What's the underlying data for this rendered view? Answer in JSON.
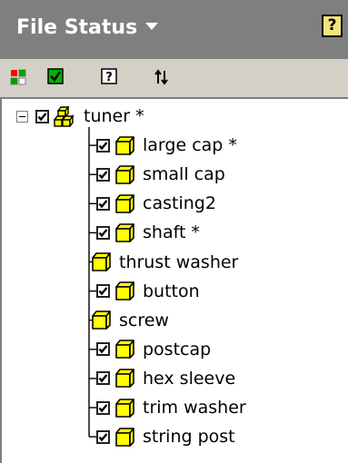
{
  "header": {
    "title": "File Status",
    "help_label": "?"
  },
  "toolbar": {
    "buttons": [
      {
        "icon": "status-grid-icon"
      },
      {
        "icon": "checkmark-icon"
      },
      {
        "icon": "query-icon"
      },
      {
        "icon": "refresh-icon"
      }
    ]
  },
  "tree": {
    "root": {
      "label": "tuner *",
      "checked": true,
      "icon": "assembly-icon",
      "expanded": true
    },
    "children": [
      {
        "label": "large cap *",
        "checked": true,
        "icon": "part-icon"
      },
      {
        "label": "small cap",
        "checked": true,
        "icon": "part-icon"
      },
      {
        "label": "casting2",
        "checked": true,
        "icon": "part-icon"
      },
      {
        "label": "shaft *",
        "checked": true,
        "icon": "part-icon"
      },
      {
        "label": "thrust washer",
        "checked": false,
        "icon": "part-icon"
      },
      {
        "label": "button",
        "checked": true,
        "icon": "part-icon"
      },
      {
        "label": "screw",
        "checked": false,
        "icon": "part-icon"
      },
      {
        "label": "postcap",
        "checked": true,
        "icon": "part-icon"
      },
      {
        "label": "hex sleeve",
        "checked": true,
        "icon": "part-icon"
      },
      {
        "label": "trim washer",
        "checked": true,
        "icon": "part-icon"
      },
      {
        "label": "string post",
        "checked": true,
        "icon": "part-icon"
      }
    ]
  },
  "colors": {
    "header_bg": "#7f7f7f",
    "toolbar_bg": "#d4d0c8",
    "part_fill": "#ffff00",
    "help_bg": "#f3e37a"
  }
}
